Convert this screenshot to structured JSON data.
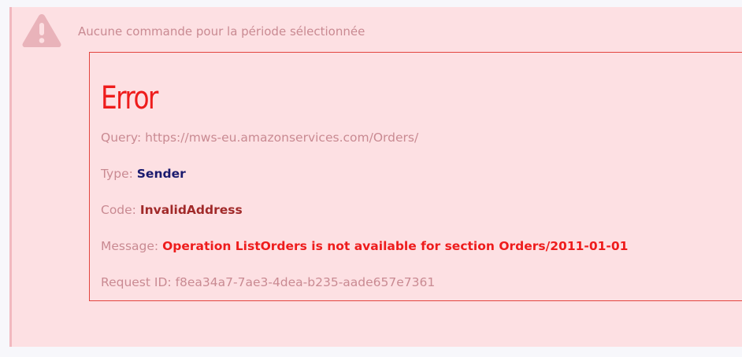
{
  "alert": {
    "icon": "warning-triangle-icon",
    "headline": "Aucune commande pour la période sélectionnée"
  },
  "error": {
    "title": "Error",
    "query_label": "Query:",
    "query_value": "https://mws-eu.amazonservices.com/Orders/",
    "type_label": "Type:",
    "type_value": "Sender",
    "code_label": "Code:",
    "code_value": "InvalidAddress",
    "message_label": "Message:",
    "message_value": "Operation ListOrders is not available for section Orders/2011-01-01",
    "request_label": "Request ID:",
    "request_value": "f8ea34a7-7ae3-4dea-b235-aade657e7361"
  },
  "colors": {
    "alert_bg": "#fde0e3",
    "alert_border": "#f2b8bf",
    "muted_text": "#c98a92",
    "error_red": "#ee1c1c",
    "type_navy": "#1a1a6e",
    "code_maroon": "#a12a2a"
  }
}
